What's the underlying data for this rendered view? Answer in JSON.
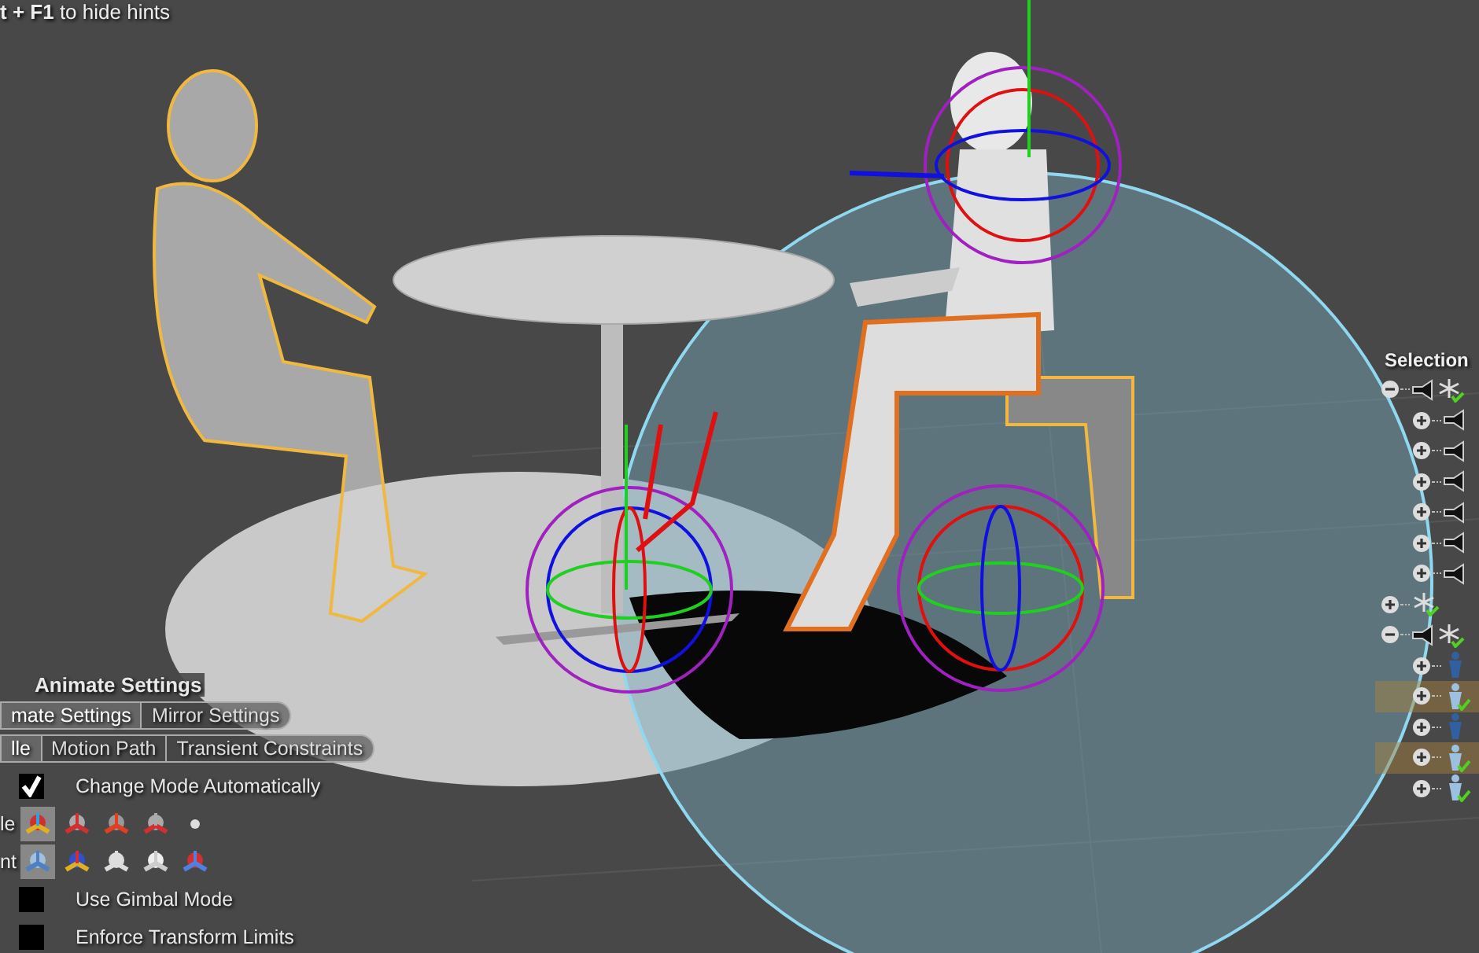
{
  "hint": "**t + F1** to hide hints",
  "panel": {
    "title": "Animate Settings",
    "tabs": [
      {
        "label": "mate Settings",
        "selected": true
      },
      {
        "label": "Mirror Settings",
        "selected": false
      }
    ],
    "subtabs": [
      {
        "label": "lle",
        "selected": true
      },
      {
        "label": "Motion Path",
        "selected": false
      },
      {
        "label": "Transient Constraints",
        "selected": false
      }
    ],
    "rows": [
      {
        "kind": "checkbox",
        "label": "Change Mode Automatically",
        "checked": true
      },
      {
        "kind": "icons",
        "label": "le",
        "icons": [
          {
            "selected": true
          },
          {
            "selected": false
          },
          {
            "selected": false
          },
          {
            "selected": false
          },
          {
            "selected": false
          }
        ]
      },
      {
        "kind": "icons",
        "label": "nt",
        "icons": [
          {
            "selected": true
          },
          {
            "selected": false
          },
          {
            "selected": false
          },
          {
            "selected": false
          },
          {
            "selected": false
          }
        ]
      },
      {
        "kind": "checkbox",
        "label": "Use Gimbal Mode",
        "checked": false
      },
      {
        "kind": "checkbox",
        "label": "Enforce Transform Limits",
        "checked": false
      }
    ]
  },
  "selection": {
    "title": "Selection",
    "items": [
      {
        "kind": "group",
        "expanded": true,
        "selected": false,
        "children": [
          {
            "kind": "joint",
            "expanded": false,
            "selected": false
          },
          {
            "kind": "joint",
            "expanded": false,
            "selected": false
          },
          {
            "kind": "joint",
            "expanded": false,
            "selected": false
          },
          {
            "kind": "joint",
            "expanded": false,
            "selected": false
          },
          {
            "kind": "joint",
            "expanded": false,
            "selected": false
          },
          {
            "kind": "joint",
            "expanded": false,
            "selected": false
          }
        ]
      },
      {
        "kind": "star",
        "expanded": false,
        "selected": false
      },
      {
        "kind": "group",
        "expanded": true,
        "selected": false,
        "children": [
          {
            "kind": "figure",
            "expanded": false,
            "selected": false
          },
          {
            "kind": "figure-checked",
            "expanded": false,
            "selected": true
          },
          {
            "kind": "figure",
            "expanded": false,
            "selected": false
          },
          {
            "kind": "figure-checked",
            "expanded": false,
            "selected": true
          },
          {
            "kind": "figure-checked",
            "expanded": false,
            "selected": false
          }
        ]
      }
    ]
  }
}
